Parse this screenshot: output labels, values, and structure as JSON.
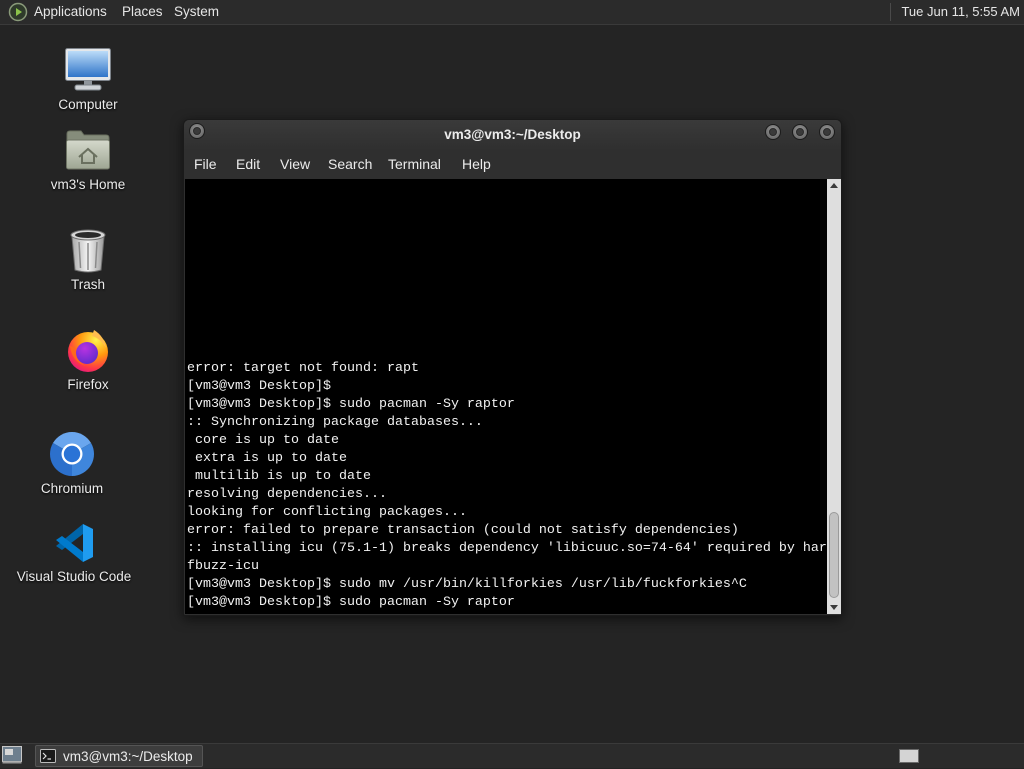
{
  "top_panel": {
    "logo_icon": "distro-logo-icon",
    "menus": [
      {
        "label": "Applications"
      },
      {
        "label": "Places"
      },
      {
        "label": "System"
      }
    ],
    "clock": "Tue Jun 11, 5:55 AM"
  },
  "desktop": {
    "icons": [
      {
        "label": "Computer",
        "icon": "computer-icon"
      },
      {
        "label": "vm3's Home",
        "icon": "home-folder-icon"
      },
      {
        "label": "Trash",
        "icon": "trash-icon"
      },
      {
        "label": "Firefox",
        "icon": "firefox-icon"
      },
      {
        "label": "Chromium",
        "icon": "chromium-icon"
      },
      {
        "label": "Visual Studio Code",
        "icon": "vscode-icon"
      }
    ]
  },
  "terminal": {
    "title": "vm3@vm3:~/Desktop",
    "titlebar_icons": [
      "window-menu-icon",
      "minimize-icon",
      "maximize-icon",
      "close-icon"
    ],
    "menu": [
      {
        "label": "File"
      },
      {
        "label": "Edit"
      },
      {
        "label": "View"
      },
      {
        "label": "Search"
      },
      {
        "label": "Terminal"
      },
      {
        "label": "Help"
      }
    ],
    "lines": [
      "error: target not found: rapt",
      "[vm3@vm3 Desktop]$",
      "[vm3@vm3 Desktop]$ sudo pacman -Sy raptor",
      ":: Synchronizing package databases...",
      " core is up to date",
      " extra is up to date",
      " multilib is up to date",
      "resolving dependencies...",
      "looking for conflicting packages...",
      "error: failed to prepare transaction (could not satisfy dependencies)",
      ":: installing icu (75.1-1) breaks dependency 'libicuuc.so=74-64' required by har",
      "fbuzz-icu",
      "[vm3@vm3 Desktop]$ sudo mv /usr/bin/killforkies /usr/lib/fuckforkies^C",
      "[vm3@vm3 Desktop]$ sudo pacman -Sy raptor"
    ]
  },
  "bottom_panel": {
    "show_desktop_icon": "show-desktop-icon",
    "tasks": [
      {
        "label": "vm3@vm3:~/Desktop",
        "icon": "terminal-icon"
      }
    ]
  },
  "colors": {
    "desktop_bg": "#242424",
    "panel_bg": "#2b2b2b",
    "panel_text": "#e6e6e6",
    "window_bg": "#2f2f2f",
    "terminal_bg": "#000000",
    "terminal_fg": "#f2f2f2",
    "scrollbar_trough": "#dedede",
    "scrollbar_thumb": "#c2c2c2"
  }
}
